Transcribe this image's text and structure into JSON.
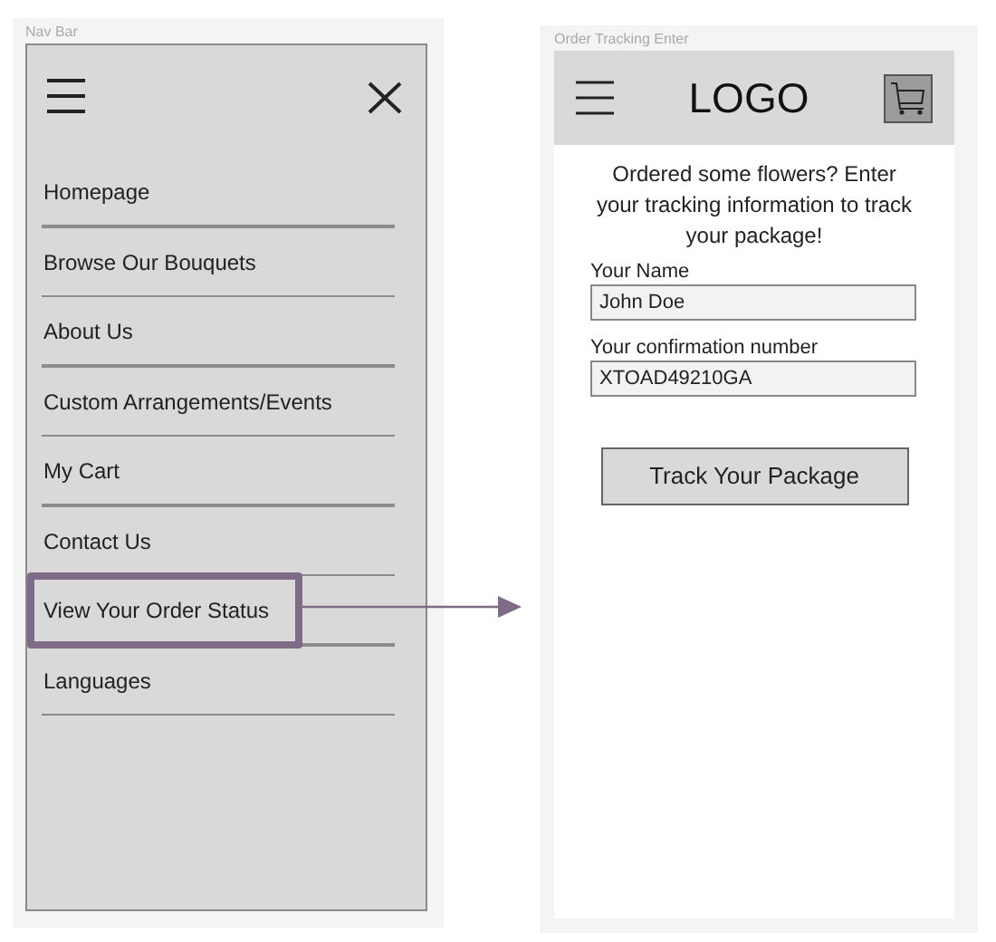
{
  "nav_frame": {
    "label": "Nav Bar",
    "items": [
      {
        "label": "Homepage",
        "selected": false
      },
      {
        "label": "Browse Our Bouquets",
        "selected": false
      },
      {
        "label": "About Us",
        "selected": false
      },
      {
        "label": "Custom Arrangements/Events",
        "selected": false
      },
      {
        "label": "My Cart",
        "selected": false
      },
      {
        "label": "Contact Us",
        "selected": false
      },
      {
        "label": "View Your Order Status",
        "selected": true
      },
      {
        "label": "Languages",
        "selected": false
      }
    ]
  },
  "tracking_frame": {
    "label": "Order Tracking Enter",
    "logo": "LOGO",
    "intro": "Ordered some flowers? Enter your tracking information to track your package!",
    "fields": [
      {
        "label": "Your Name",
        "value": "John Doe"
      },
      {
        "label": "Your confirmation number",
        "value": "XTOAD49210GA"
      }
    ],
    "button": "Track Your Package"
  }
}
